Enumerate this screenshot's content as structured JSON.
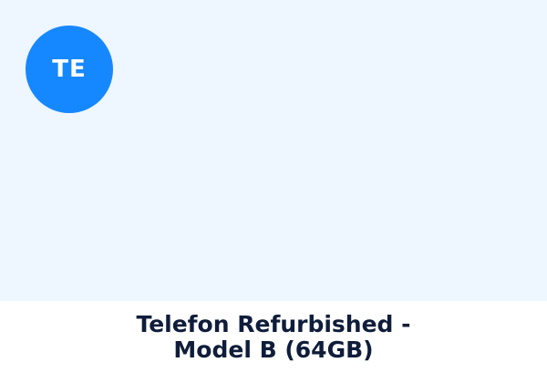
{
  "avatar": {
    "initials": "TE",
    "color": "#1688ff"
  },
  "product": {
    "title": "Telefon Refurbished -\nModel B (64GB)"
  },
  "colors": {
    "image_background": "#eef6ff",
    "title_text": "#0f1d3a",
    "card_background": "#ffffff"
  }
}
